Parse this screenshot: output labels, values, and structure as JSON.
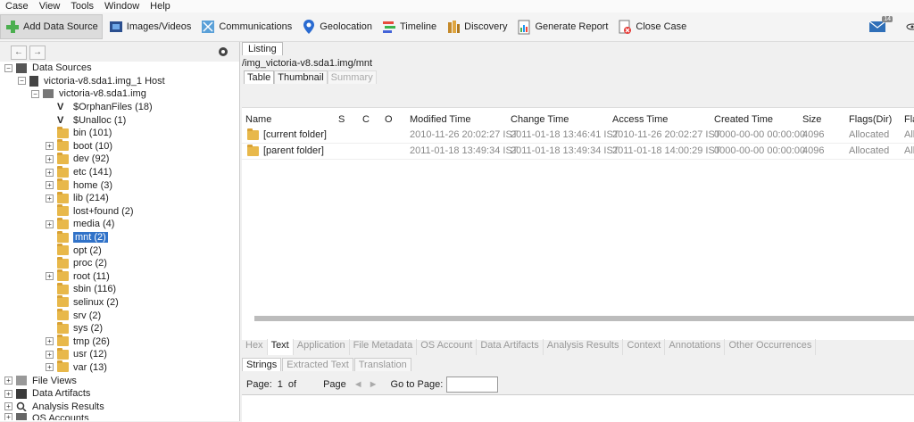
{
  "menu": [
    "Case",
    "View",
    "Tools",
    "Window",
    "Help"
  ],
  "toolbar": {
    "add_data_source": "Add Data Source",
    "images_videos": "Images/Videos",
    "communications": "Communications",
    "geolocation": "Geolocation",
    "timeline": "Timeline",
    "discovery": "Discovery",
    "generate_report": "Generate Report",
    "close_case": "Close Case",
    "notif_count": "14"
  },
  "tree": {
    "data_sources": "Data Sources",
    "host": "victoria-v8.sda1.img_1 Host",
    "image": "victoria-v8.sda1.img",
    "items": [
      "$OrphanFiles (18)",
      "$Unalloc (1)",
      "bin (101)",
      "boot (10)",
      "dev (92)",
      "etc (141)",
      "home (3)",
      "lib (214)",
      "lost+found (2)",
      "media (4)",
      "mnt (2)",
      "opt (2)",
      "proc (2)",
      "root (11)",
      "sbin (116)",
      "selinux (2)",
      "srv (2)",
      "sys (2)",
      "tmp (26)",
      "usr (12)",
      "var (13)"
    ],
    "file_views": "File Views",
    "data_artifacts": "Data Artifacts",
    "analysis_results": "Analysis Results",
    "os_accounts": "OS Accounts"
  },
  "listing": {
    "tab": "Listing",
    "path": "/img_victoria-v8.sda1.img/mnt",
    "subtabs": [
      "Table",
      "Thumbnail",
      "Summary"
    ],
    "columns": [
      "Name",
      "S",
      "C",
      "O",
      "Modified Time",
      "Change Time",
      "Access Time",
      "Created Time",
      "Size",
      "Flags(Dir)",
      "Fla"
    ],
    "rows": [
      {
        "name": "[current folder]",
        "modified": "2010-11-26 20:02:27 IST",
        "change": "2011-01-18 13:46:41 IST",
        "access": "2010-11-26 20:02:27 IST",
        "created": "0000-00-00 00:00:00",
        "size": "4096",
        "flags": "Allocated",
        "fla": "Allo"
      },
      {
        "name": "[parent folder]",
        "modified": "2011-01-18 13:49:34 IST",
        "change": "2011-01-18 13:49:34 IST",
        "access": "2011-01-18 14:00:29 IST",
        "created": "0000-00-00 00:00:00",
        "size": "4096",
        "flags": "Allocated",
        "fla": "Allo"
      }
    ]
  },
  "content_tabs": [
    "Hex",
    "Text",
    "Application",
    "File Metadata",
    "OS Account",
    "Data Artifacts",
    "Analysis Results",
    "Context",
    "Annotations",
    "Other Occurrences"
  ],
  "text_tabs": [
    "Strings",
    "Extracted Text",
    "Translation"
  ],
  "pager": {
    "page_label": "Page:",
    "page_value": "1",
    "of_label": "of",
    "page2": "Page",
    "goto": "Go to Page:"
  }
}
